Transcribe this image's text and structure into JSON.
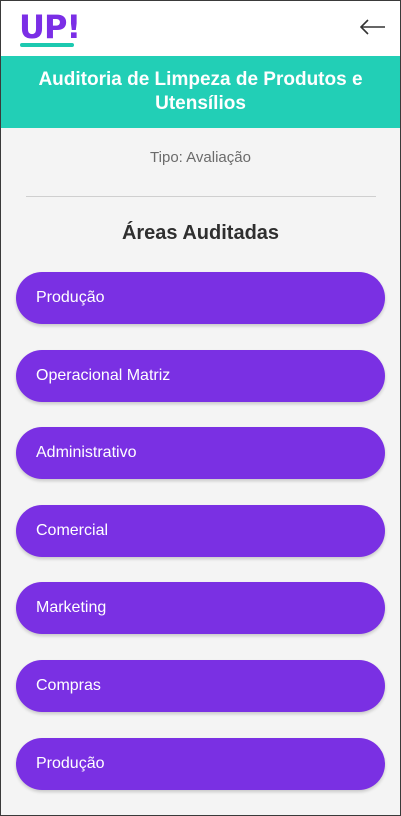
{
  "app": {
    "logo_text": "UP!"
  },
  "header": {
    "title": "Auditoria de Limpeza de Produtos e Utensílios"
  },
  "info": {
    "tipo": "Tipo: Avaliação"
  },
  "section": {
    "title": "Áreas Auditadas"
  },
  "areas": [
    {
      "label": "Produção"
    },
    {
      "label": "Operacional Matriz"
    },
    {
      "label": "Administrativo"
    },
    {
      "label": "Comercial"
    },
    {
      "label": "Marketing"
    },
    {
      "label": "Compras"
    },
    {
      "label": "Produção"
    }
  ],
  "colors": {
    "brand_purple": "#7a30e3",
    "brand_teal": "#22cfb6"
  },
  "icons": {
    "back": "arrow-left-icon"
  }
}
